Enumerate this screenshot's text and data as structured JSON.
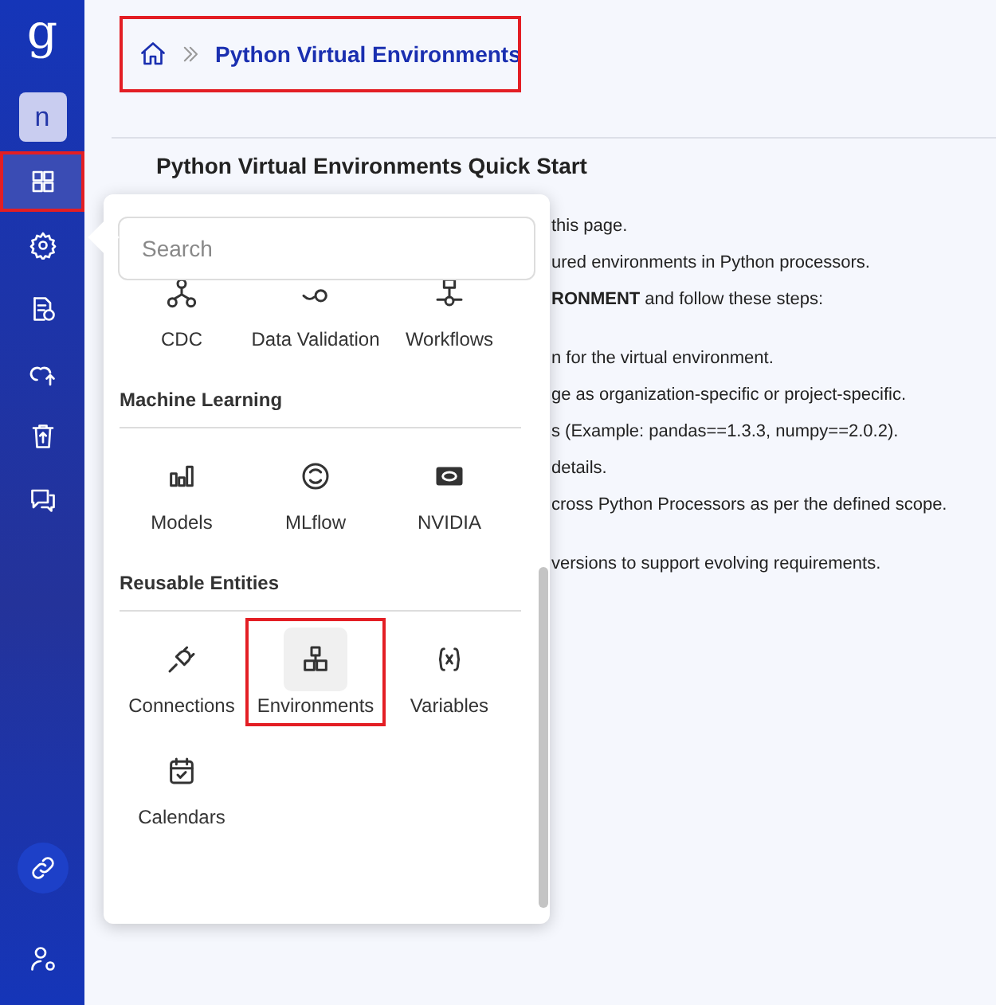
{
  "sidebar": {
    "logo": "g",
    "avatar": "n",
    "items": [
      {
        "selected": true,
        "highlighted": true
      },
      {
        "selected": false,
        "highlighted": false
      },
      {
        "selected": false,
        "highlighted": false
      },
      {
        "selected": false,
        "highlighted": false
      },
      {
        "selected": false,
        "highlighted": false
      },
      {
        "selected": false,
        "highlighted": false
      }
    ]
  },
  "breadcrumb": {
    "title": "Python Virtual Environments",
    "highlighted": true
  },
  "content": {
    "heading": "Python Virtual Environments Quick Start",
    "paragraphs": [
      [
        "this page.",
        "ured environments in Python processors.",
        "**RONMENT** and follow these steps:"
      ],
      [
        "n for the virtual environment.",
        "ge as organization-specific or project-specific.",
        "s (Example: pandas==1.3.3, numpy==2.0.2).",
        "details.",
        "cross Python Processors as per the defined scope."
      ],
      [
        "versions to support evolving requirements."
      ]
    ]
  },
  "menu": {
    "search": {
      "placeholder": "Search"
    },
    "sections": [
      {
        "items": [
          {
            "label": "CDC",
            "selected": false,
            "highlighted": false
          },
          {
            "label": "Data Validation",
            "selected": false,
            "highlighted": false
          },
          {
            "label": "Workflows",
            "selected": false,
            "highlighted": false
          }
        ]
      },
      {
        "title": "Machine Learning",
        "items": [
          {
            "label": "Models",
            "selected": false,
            "highlighted": false
          },
          {
            "label": "MLflow",
            "selected": false,
            "highlighted": false
          },
          {
            "label": "NVIDIA",
            "selected": false,
            "highlighted": false
          }
        ]
      },
      {
        "title": "Reusable Entities",
        "items": [
          {
            "label": "Connections",
            "selected": false,
            "highlighted": false
          },
          {
            "label": "Environments",
            "selected": true,
            "highlighted": true
          },
          {
            "label": "Variables",
            "selected": false,
            "highlighted": false
          },
          {
            "label": "Calendars",
            "selected": false,
            "highlighted": false
          }
        ]
      }
    ]
  }
}
